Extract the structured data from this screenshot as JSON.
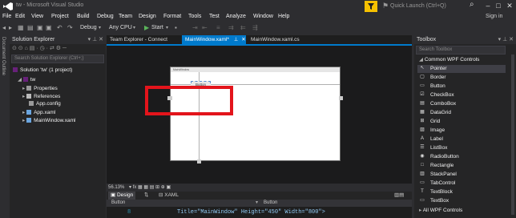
{
  "app": {
    "title": "tw - Microsoft Visual Studio",
    "signin": "Sign in",
    "quick_launch": "Quick Launch (Ctrl+Q)"
  },
  "menu": [
    "File",
    "Edit",
    "View",
    "Project",
    "Build",
    "Debug",
    "Team",
    "Design",
    "Format",
    "Tools",
    "Test",
    "Analyze",
    "Window",
    "Help"
  ],
  "toolbar": {
    "config": "Debug",
    "platform": "Any CPU",
    "start": "Start"
  },
  "side_tabs": {
    "document_outline": "Document Outline"
  },
  "solution_explorer": {
    "title": "Solution Explorer",
    "search_placeholder": "Search Solution Explorer (Ctrl+;)",
    "solution": "Solution 'tw' (1 project)",
    "project": "tw",
    "items": [
      "Properties",
      "References",
      "App.config",
      "App.xaml",
      "MainWindow.xaml"
    ]
  },
  "tabs": [
    "Team Explorer - Connect",
    "MainWindow.xaml*",
    "MainWindow.xaml.cs"
  ],
  "designer": {
    "window_title": "MainWindow",
    "button_label": "Button",
    "zoom": "56.13%",
    "design_tab": "Design",
    "xaml_tab": "XAML",
    "element_left": "Button",
    "element_right": "Button",
    "line_number": "8",
    "xaml_code": "Title=\"MainWindow\" Height=\"450\" Width=\"800\">"
  },
  "toolbox": {
    "title": "Toolbox",
    "search_placeholder": "Search Toolbox",
    "group": "Common WPF Controls",
    "items": [
      "Pointer",
      "Border",
      "Button",
      "CheckBox",
      "ComboBox",
      "DataGrid",
      "Grid",
      "Image",
      "Label",
      "ListBox",
      "RadioButton",
      "Rectangle",
      "StackPanel",
      "TabControl",
      "TextBlock",
      "TextBox"
    ],
    "group2": "All WPF Controls"
  },
  "colors": {
    "accent": "#007acc",
    "highlight": "#e3141b",
    "filter": "#f6c100",
    "purple": "#68217a"
  }
}
